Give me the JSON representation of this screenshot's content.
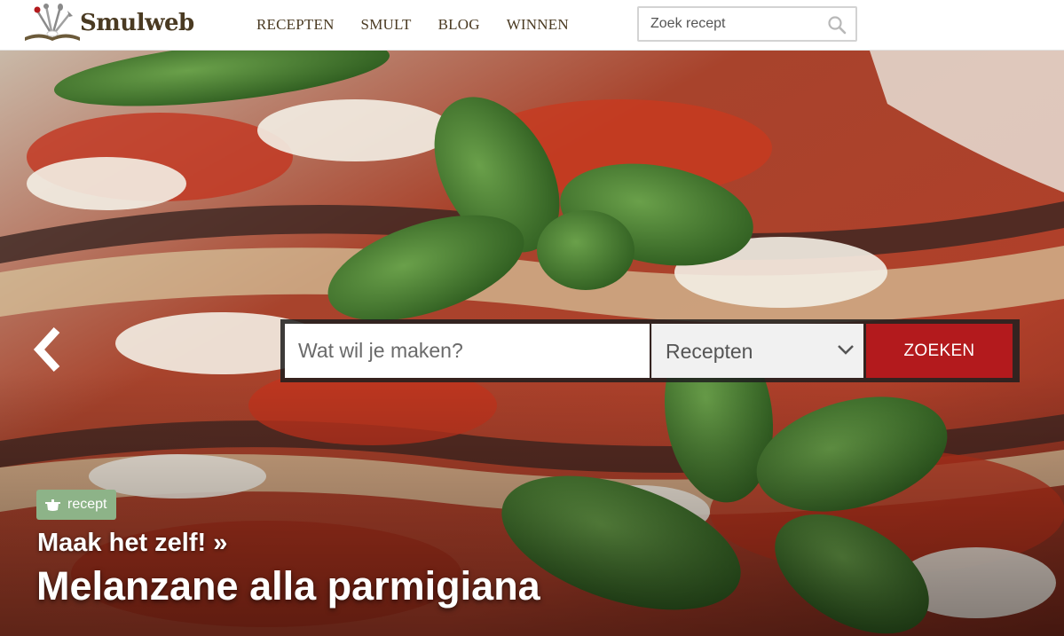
{
  "header": {
    "logo_text": "Smulweb",
    "nav": [
      {
        "label": "RECEPTEN"
      },
      {
        "label": "SMULT"
      },
      {
        "label": "BLOG"
      },
      {
        "label": "WINNEN"
      }
    ],
    "search": {
      "placeholder": "Zoek recept",
      "icon": "search-icon"
    }
  },
  "hero": {
    "search": {
      "placeholder": "Wat wil je maken?",
      "category_selected": "Recepten",
      "submit_label": "ZOEKEN"
    },
    "badge": {
      "label": "recept",
      "icon": "cooking-pot-icon"
    },
    "kicker": "Maak het zelf! »",
    "title": "Melanzane alla parmigiana",
    "nav_prev_icon": "chevron-left-icon"
  },
  "colors": {
    "brand_text": "#4a3a22",
    "accent_red": "#b31a1d",
    "badge_green": "#8db388"
  }
}
